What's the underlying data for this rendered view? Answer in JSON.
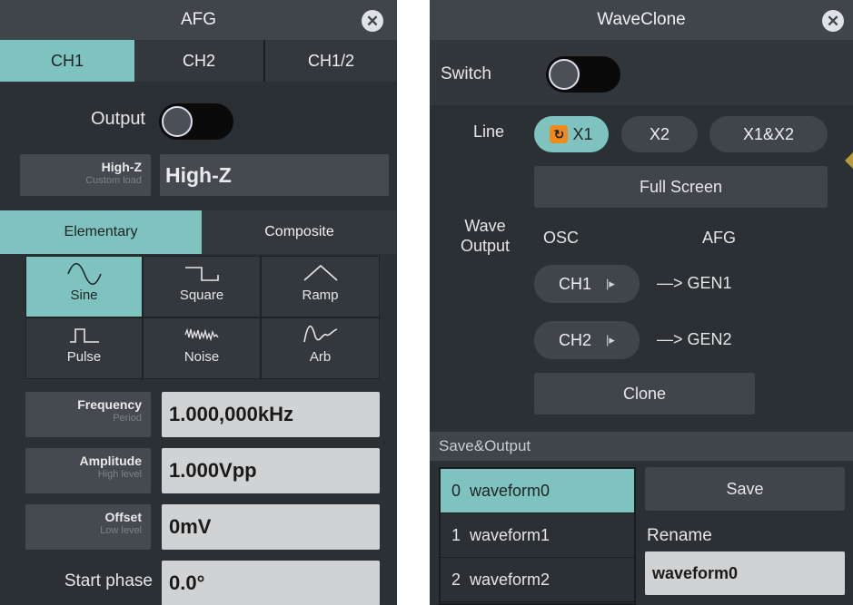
{
  "afg": {
    "title": "AFG",
    "close_glyph": "✕",
    "tabs": [
      {
        "label": "CH1",
        "active": true
      },
      {
        "label": "CH2",
        "active": false
      },
      {
        "label": "CH1/2",
        "active": false
      }
    ],
    "output_label": "Output",
    "output_on": false,
    "load": {
      "primary": "High-Z",
      "secondary": "Custom load",
      "value": "High-Z"
    },
    "modes": [
      {
        "label": "Elementary",
        "active": true
      },
      {
        "label": "Composite",
        "active": false
      }
    ],
    "waveforms": [
      {
        "label": "Sine",
        "icon": "sine-wave-icon",
        "active": true
      },
      {
        "label": "Square",
        "icon": "square-wave-icon",
        "active": false
      },
      {
        "label": "Ramp",
        "icon": "ramp-wave-icon",
        "active": false
      },
      {
        "label": "Pulse",
        "icon": "pulse-wave-icon",
        "active": false
      },
      {
        "label": "Noise",
        "icon": "noise-wave-icon",
        "active": false
      },
      {
        "label": "Arb",
        "icon": "arb-wave-icon",
        "active": false
      }
    ],
    "params": [
      {
        "primary": "Frequency",
        "secondary": "Period",
        "value": "1.000,000kHz"
      },
      {
        "primary": "Amplitude",
        "secondary": "High level",
        "value": "1.000Vpp"
      },
      {
        "primary": "Offset",
        "secondary": "Low level",
        "value": "0mV"
      }
    ],
    "start_phase": {
      "label": "Start phase",
      "value": "0.0°"
    }
  },
  "waveclone": {
    "title": "WaveClone",
    "close_glyph": "✕",
    "switch_label": "Switch",
    "switch_on": false,
    "line_label": "Line",
    "line_options": [
      {
        "label": "X1",
        "active": true
      },
      {
        "label": "X2",
        "active": false
      },
      {
        "label": "X1&X2",
        "active": false
      }
    ],
    "full_screen_label": "Full Screen",
    "wave_output_label": "Wave Output",
    "osc_label": "OSC",
    "afg_label": "AFG",
    "mappings": [
      {
        "channel": "CH1",
        "target": "—> GEN1"
      },
      {
        "channel": "CH2",
        "target": "—> GEN2"
      }
    ],
    "clone_label": "Clone",
    "save_output_label": "Save&Output",
    "waveform_list": [
      {
        "index": "0",
        "name": "waveform0",
        "active": true
      },
      {
        "index": "1",
        "name": "waveform1",
        "active": false
      },
      {
        "index": "2",
        "name": "waveform2",
        "active": false
      }
    ],
    "save_label": "Save",
    "rename_label": "Rename",
    "rename_value": "waveform0"
  },
  "colors": {
    "accent": "#7ec3bf",
    "panel_bg": "#2b3035",
    "title_bg": "#3f454b",
    "value_field_bg": "#d0d2d4",
    "pill_orange": "#f08a1c"
  }
}
